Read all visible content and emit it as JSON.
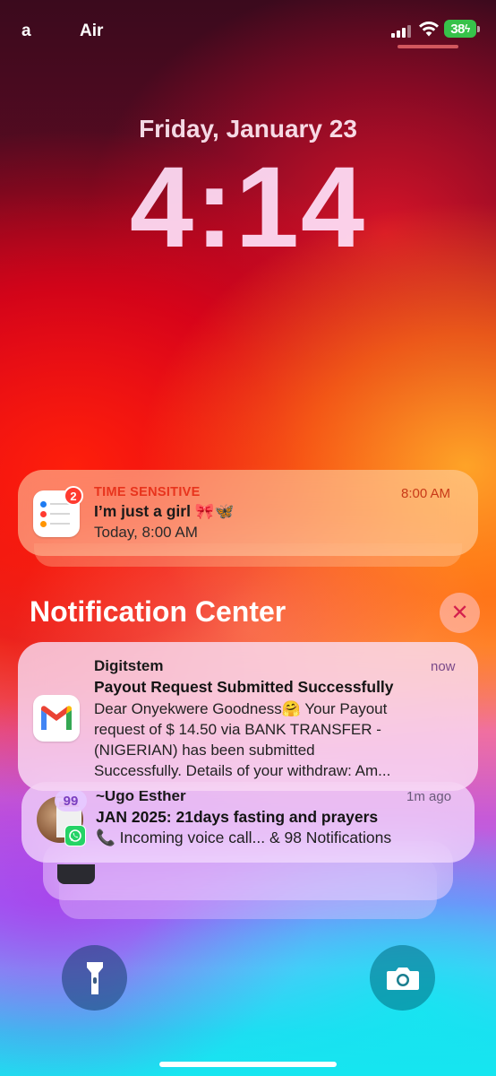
{
  "status_bar": {
    "carrier_left": "a",
    "carrier_right": "Air",
    "battery_level": "38",
    "battery_color": "#37c24a",
    "icons": [
      "signal-icon",
      "wifi-icon",
      "battery-charging-icon"
    ]
  },
  "lock_screen": {
    "date": "Friday, January 23",
    "time": "4:14"
  },
  "notifications": {
    "reminder": {
      "app_icon": "reminders-icon",
      "badge": "2",
      "label": "TIME SENSITIVE",
      "time": "8:00 AM",
      "title": "I’m just a girl 🎀🦋",
      "subtitle": "Today, 8:00 AM",
      "accent_color": "#e8341d"
    },
    "center": {
      "title": "Notification Center",
      "close_icon": "close-icon"
    },
    "gmail": {
      "app_icon": "gmail-icon",
      "sender": "Digitstem",
      "time": "now",
      "subject": "Payout Request Submitted Successfully",
      "body_lines": [
        "Dear Onyekwere Goodness🤗 Your Payout",
        "request of $ 14.50 via BANK TRANSFER -",
        "(NIGERIAN) has been submitted",
        "Successfully. Details of your withdraw: Am..."
      ]
    },
    "whatsapp": {
      "app_icon": "whatsapp-icon",
      "badge": "99",
      "sender": "~Ugo Esther",
      "time": "1m ago",
      "title": "JAN 2025: 21days fasting and prayers",
      "body": "📞 Incoming voice call... & 98 Notifications"
    }
  },
  "bottom_controls": {
    "left": "flashlight-icon",
    "right": "camera-icon"
  }
}
